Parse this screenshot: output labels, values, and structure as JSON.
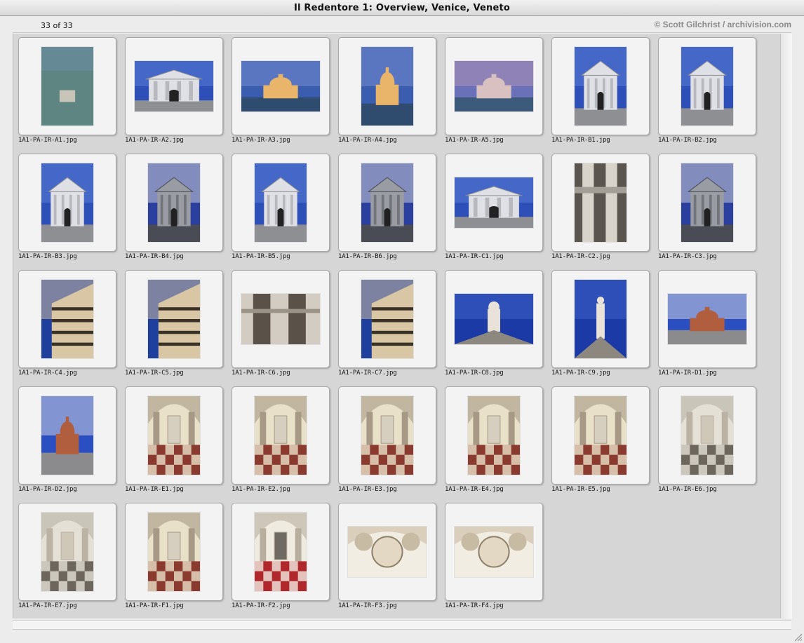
{
  "window": {
    "title": "Il Redentore 1: Overview, Venice, Veneto"
  },
  "header": {
    "count": "33 of 33",
    "credit": "© Scott Gilchrist / archivision.com"
  },
  "items": [
    {
      "file": "1A1-PA-IR-A1.jpg",
      "orient": "portrait",
      "scene": "aerial"
    },
    {
      "file": "1A1-PA-IR-A2.jpg",
      "orient": "landscape",
      "scene": "facade-sky"
    },
    {
      "file": "1A1-PA-IR-A3.jpg",
      "orient": "landscape",
      "scene": "sunset"
    },
    {
      "file": "1A1-PA-IR-A4.jpg",
      "orient": "portrait",
      "scene": "sunset"
    },
    {
      "file": "1A1-PA-IR-A5.jpg",
      "orient": "landscape",
      "scene": "dusk"
    },
    {
      "file": "1A1-PA-IR-B1.jpg",
      "orient": "portrait",
      "scene": "facade-sky"
    },
    {
      "file": "1A1-PA-IR-B2.jpg",
      "orient": "portrait",
      "scene": "facade-sky"
    },
    {
      "file": "1A1-PA-IR-B3.jpg",
      "orient": "portrait",
      "scene": "facade-sky"
    },
    {
      "file": "1A1-PA-IR-B4.jpg",
      "orient": "portrait",
      "scene": "stone"
    },
    {
      "file": "1A1-PA-IR-B5.jpg",
      "orient": "portrait",
      "scene": "facade-sky"
    },
    {
      "file": "1A1-PA-IR-B6.jpg",
      "orient": "portrait",
      "scene": "stone"
    },
    {
      "file": "1A1-PA-IR-C1.jpg",
      "orient": "landscape",
      "scene": "facade-sky"
    },
    {
      "file": "1A1-PA-IR-C2.jpg",
      "orient": "portrait",
      "scene": "column"
    },
    {
      "file": "1A1-PA-IR-C3.jpg",
      "orient": "portrait",
      "scene": "stone"
    },
    {
      "file": "1A1-PA-IR-C4.jpg",
      "orient": "portrait",
      "scene": "cornice"
    },
    {
      "file": "1A1-PA-IR-C5.jpg",
      "orient": "portrait",
      "scene": "cornice"
    },
    {
      "file": "1A1-PA-IR-C6.jpg",
      "orient": "landscape",
      "scene": "capital"
    },
    {
      "file": "1A1-PA-IR-C7.jpg",
      "orient": "portrait",
      "scene": "cornice"
    },
    {
      "file": "1A1-PA-IR-C8.jpg",
      "orient": "landscape",
      "scene": "statue"
    },
    {
      "file": "1A1-PA-IR-C9.jpg",
      "orient": "portrait",
      "scene": "statue"
    },
    {
      "file": "1A1-PA-IR-D1.jpg",
      "orient": "landscape",
      "scene": "dome"
    },
    {
      "file": "1A1-PA-IR-D2.jpg",
      "orient": "portrait",
      "scene": "dome"
    },
    {
      "file": "1A1-PA-IR-E1.jpg",
      "orient": "portrait",
      "scene": "nave"
    },
    {
      "file": "1A1-PA-IR-E2.jpg",
      "orient": "portrait",
      "scene": "nave"
    },
    {
      "file": "1A1-PA-IR-E3.jpg",
      "orient": "portrait",
      "scene": "nave"
    },
    {
      "file": "1A1-PA-IR-E4.jpg",
      "orient": "portrait",
      "scene": "nave"
    },
    {
      "file": "1A1-PA-IR-E5.jpg",
      "orient": "portrait",
      "scene": "nave"
    },
    {
      "file": "1A1-PA-IR-E6.jpg",
      "orient": "portrait",
      "scene": "chapel"
    },
    {
      "file": "1A1-PA-IR-E7.jpg",
      "orient": "portrait",
      "scene": "chapel"
    },
    {
      "file": "1A1-PA-IR-F1.jpg",
      "orient": "portrait",
      "scene": "nave"
    },
    {
      "file": "1A1-PA-IR-F2.jpg",
      "orient": "portrait",
      "scene": "altar"
    },
    {
      "file": "1A1-PA-IR-F3.jpg",
      "orient": "landscape",
      "scene": "vault"
    },
    {
      "file": "1A1-PA-IR-F4.jpg",
      "orient": "landscape",
      "scene": "vault"
    }
  ],
  "palettes": {
    "aerial": [
      "#6f8fa8",
      "#5e8582",
      "#4b726c",
      "#c9c4b8"
    ],
    "facade-sky": [
      "#2e4fb8",
      "#5b7fd6",
      "#dfe0e6",
      "#8e8f93"
    ],
    "sunset": [
      "#3a5db0",
      "#7a8fcf",
      "#e9b56a",
      "#2f4b6e"
    ],
    "dusk": [
      "#6b71b8",
      "#b394b6",
      "#d8c1c0",
      "#3d5a7a"
    ],
    "stone": [
      "#2a3f9e",
      "#d9d9dc",
      "#9a9ca3",
      "#4a4c55"
    ],
    "column": [
      "#d8d4cc",
      "#a39e96",
      "#5a564f",
      "#e8e6e0"
    ],
    "cornice": [
      "#1f3f9c",
      "#d9c6a4",
      "#8a7a62",
      "#3a3127"
    ],
    "capital": [
      "#5a5249",
      "#9c9388",
      "#d3ccc2",
      "#2e2a25"
    ],
    "statue": [
      "#1c3aa6",
      "#3f62c9",
      "#e8e2d8",
      "#8c8880"
    ],
    "dome": [
      "#2b4fc1",
      "#d9dce4",
      "#b05e3e",
      "#8b8a8c"
    ],
    "nave": [
      "#e8e0c8",
      "#a69a86",
      "#8a3a2e",
      "#d6cfc0"
    ],
    "chapel": [
      "#e4e0d6",
      "#b9b2a5",
      "#6d665d",
      "#cfc7b8"
    ],
    "altar": [
      "#f0ebe0",
      "#b8ae9e",
      "#b0272c",
      "#6f6a62"
    ],
    "vault": [
      "#f2ede2",
      "#c8bba4",
      "#8e806a",
      "#e2d8c4"
    ]
  }
}
